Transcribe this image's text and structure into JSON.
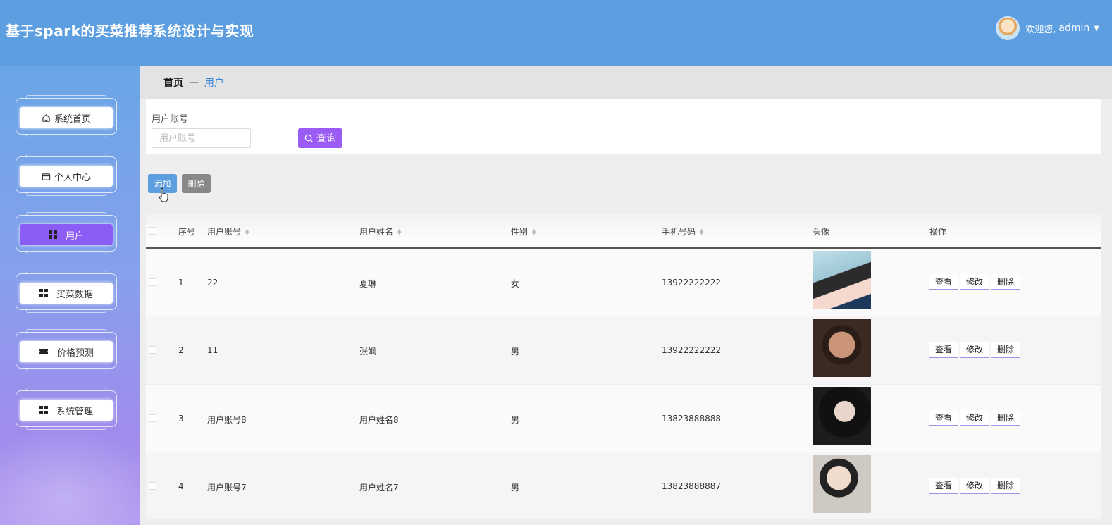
{
  "header": {
    "title": "基于spark的买菜推荐系统设计与实现",
    "greeting_prefix": "欢迎您,",
    "username": "admin"
  },
  "sidebar": {
    "items": [
      {
        "label": "系统首页",
        "icon": "home-icon"
      },
      {
        "label": "个人中心",
        "icon": "wallet-icon"
      },
      {
        "label": "用户",
        "icon": "grid-icon",
        "active": true
      },
      {
        "label": "买菜数据",
        "icon": "grid-icon"
      },
      {
        "label": "价格预测",
        "icon": "ticket-icon"
      },
      {
        "label": "系统管理",
        "icon": "grid-icon"
      }
    ]
  },
  "breadcrumb": {
    "home": "首页",
    "separator": "—",
    "current": "用户"
  },
  "search": {
    "label": "用户账号",
    "placeholder": "用户账号",
    "query_button": "查询"
  },
  "actions": {
    "add": "添加",
    "delete": "删除"
  },
  "table": {
    "columns": {
      "index": "序号",
      "account": "用户账号",
      "name": "用户姓名",
      "gender": "性别",
      "phone": "手机号码",
      "avatar": "头像",
      "ops": "操作"
    },
    "rows": [
      {
        "index": "1",
        "account": "22",
        "name": "夏琳",
        "gender": "女",
        "phone": "13922222222",
        "avatar_color": "#9fc7d6"
      },
      {
        "index": "2",
        "account": "11",
        "name": "张飒",
        "gender": "男",
        "phone": "13922222222",
        "avatar_color": "#3a2a22"
      },
      {
        "index": "3",
        "account": "用户账号8",
        "name": "用户姓名8",
        "gender": "男",
        "phone": "13823888888",
        "avatar_color": "#1c1c1c"
      },
      {
        "index": "4",
        "account": "用户账号7",
        "name": "用户姓名7",
        "gender": "男",
        "phone": "13823888887",
        "avatar_color": "#cfc9c4"
      }
    ],
    "row_actions": {
      "view": "查看",
      "edit": "修改",
      "delete": "删除"
    }
  },
  "colors": {
    "header_bg": "#5d9ee0",
    "accent_purple": "#8b5cf6",
    "link_blue": "#3a87d6"
  }
}
